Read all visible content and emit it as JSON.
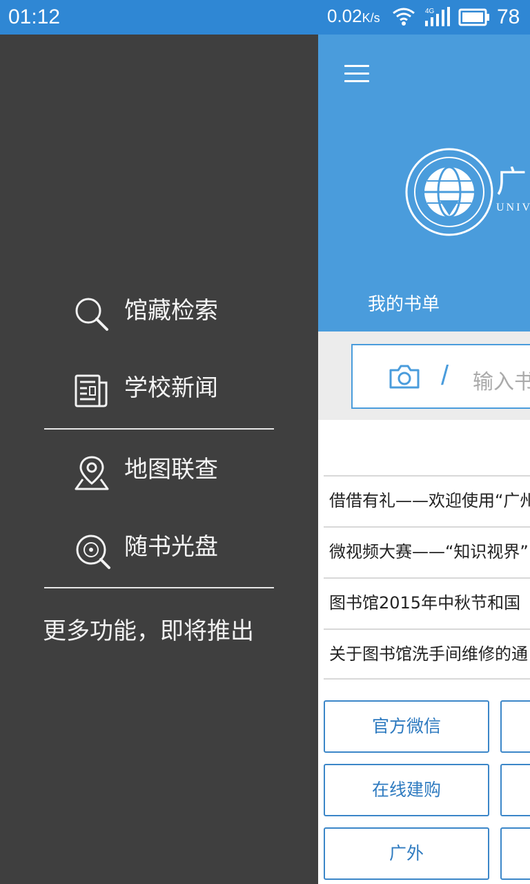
{
  "status_bar": {
    "time": "01:12",
    "net_speed": "0.02",
    "net_unit": "K/s",
    "network_type": "4G",
    "battery": "78"
  },
  "header": {
    "logo_cn_char": "广",
    "logo_en_fragment": "UNIV",
    "my_booklist_label": "我的书单"
  },
  "search": {
    "placeholder": "输入书"
  },
  "news": [
    {
      "title": "借借有礼——欢迎使用“广州"
    },
    {
      "title": "微视频大赛——“知识视界”"
    },
    {
      "title": "图书馆2015年中秋节和国"
    },
    {
      "title": "关于图书馆洗手间维修的通"
    }
  ],
  "quick_links": [
    {
      "label": "官方微信"
    },
    {
      "label": "在线建购"
    },
    {
      "label": "广外"
    }
  ],
  "drawer": {
    "items": [
      {
        "label": "馆藏检索",
        "icon": "search-icon"
      },
      {
        "label": "学校新闻",
        "icon": "newspaper-icon"
      },
      {
        "label": "地图联查",
        "icon": "map-pin-icon"
      },
      {
        "label": "随书光盘",
        "icon": "disc-search-icon"
      }
    ],
    "more_text": "更多功能，即将推出"
  },
  "colors": {
    "status_bar": "#2f87d4",
    "header_blue": "#4a9cdc",
    "drawer_bg": "#3f3f3f",
    "accent": "#3b86c8"
  }
}
